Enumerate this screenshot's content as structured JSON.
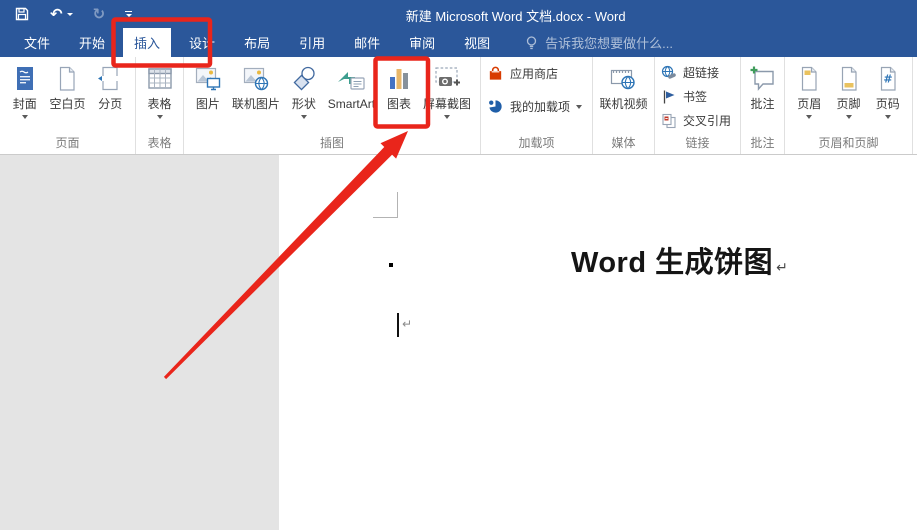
{
  "colors": {
    "titlebar_blue": "#2b579a",
    "annotation_red": "#e9251b"
  },
  "window": {
    "title": "新建 Microsoft Word 文档.docx - Word"
  },
  "qat": {
    "undo_glyph": "↶",
    "redo_glyph": "↻"
  },
  "tabs": [
    {
      "label": "文件",
      "selected": false
    },
    {
      "label": "开始",
      "selected": false
    },
    {
      "label": "插入",
      "selected": true
    },
    {
      "label": "设计",
      "selected": false
    },
    {
      "label": "布局",
      "selected": false
    },
    {
      "label": "引用",
      "selected": false
    },
    {
      "label": "邮件",
      "selected": false
    },
    {
      "label": "审阅",
      "selected": false
    },
    {
      "label": "视图",
      "selected": false
    }
  ],
  "tell_me": {
    "text": "告诉我您想要做什么..."
  },
  "ribbon": {
    "groups": [
      {
        "label": "页面",
        "buttons": [
          {
            "label": "封面",
            "dropdown": true
          },
          {
            "label": "空白页"
          },
          {
            "label": "分页"
          }
        ]
      },
      {
        "label": "表格",
        "buttons": [
          {
            "label": "表格",
            "dropdown": true
          }
        ]
      },
      {
        "label": "插图",
        "buttons": [
          {
            "label": "图片"
          },
          {
            "label": "联机图片"
          },
          {
            "label": "形状",
            "dropdown": true
          },
          {
            "label": "SmartArt"
          },
          {
            "label": "图表",
            "highlighted": true
          },
          {
            "label": "屏幕截图",
            "dropdown": true
          }
        ]
      },
      {
        "label": "加载项",
        "buttons": [
          {
            "label": "应用商店"
          },
          {
            "label": "我的加载项",
            "dropdown": true
          }
        ]
      },
      {
        "label": "媒体",
        "buttons": [
          {
            "label": "联机视频"
          }
        ]
      },
      {
        "label": "链接",
        "buttons": [
          {
            "label": "超链接"
          },
          {
            "label": "书签"
          },
          {
            "label": "交叉引用"
          }
        ]
      },
      {
        "label": "批注",
        "buttons": [
          {
            "label": "批注"
          }
        ]
      },
      {
        "label": "页眉和页脚",
        "buttons": [
          {
            "label": "页眉",
            "dropdown": true
          },
          {
            "label": "页脚",
            "dropdown": true
          },
          {
            "label": "页码",
            "dropdown": true
          }
        ]
      }
    ]
  },
  "document": {
    "heading": "Word 生成饼图",
    "paragraph_mark": "↵"
  }
}
